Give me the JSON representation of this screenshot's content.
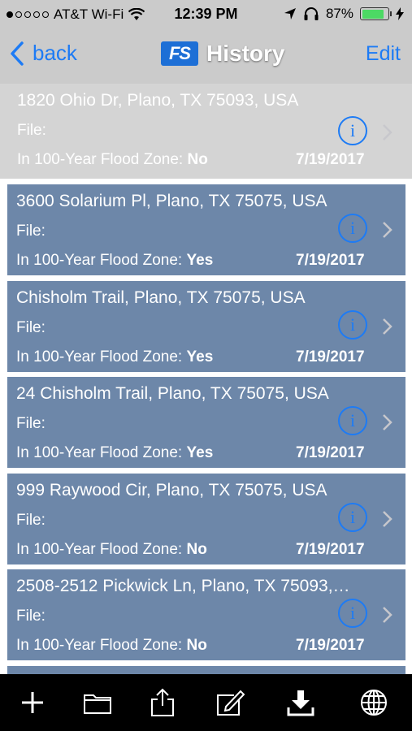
{
  "status_bar": {
    "carrier": "AT&T Wi-Fi",
    "time": "12:39 PM",
    "battery_percent": "87%",
    "battery_level": 0.87,
    "signal_dots_filled": 1,
    "signal_dots_total": 5
  },
  "nav": {
    "back_label": "back",
    "logo_text": "FS",
    "title": "History",
    "edit_label": "Edit"
  },
  "rows": [
    {
      "address": "1820 Ohio Dr, Plano, TX 75093, USA",
      "file_label": "File:",
      "flood_label": "In 100-Year Flood Zone:",
      "flood_value": "No",
      "date": "7/19/2017",
      "info_glyph": "i",
      "selected": true
    },
    {
      "address": "3600 Solarium Pl, Plano, TX 75075, USA",
      "file_label": "File:",
      "flood_label": "In 100-Year Flood Zone:",
      "flood_value": "Yes",
      "date": "7/19/2017",
      "info_glyph": "i"
    },
    {
      "address": "Chisholm Trail, Plano, TX 75075, USA",
      "file_label": "File:",
      "flood_label": "In 100-Year Flood Zone:",
      "flood_value": "Yes",
      "date": "7/19/2017",
      "info_glyph": "i"
    },
    {
      "address": "24 Chisholm Trail, Plano, TX 75075, USA",
      "file_label": "File:",
      "flood_label": "In 100-Year Flood Zone:",
      "flood_value": "Yes",
      "date": "7/19/2017",
      "info_glyph": "i"
    },
    {
      "address": "999 Raywood Cir, Plano, TX 75075, USA",
      "file_label": "File:",
      "flood_label": "In 100-Year Flood Zone:",
      "flood_value": "No",
      "date": "7/19/2017",
      "info_glyph": "i"
    },
    {
      "address": "2508-2512 Pickwick Ln, Plano, TX 75093,…",
      "file_label": "File:",
      "flood_label": "In 100-Year Flood Zone:",
      "flood_value": "No",
      "date": "7/19/2017",
      "info_glyph": "i"
    }
  ],
  "toolbar": {
    "icons": [
      "add-icon",
      "folder-icon",
      "share-icon",
      "compose-icon",
      "download-icon",
      "globe-icon"
    ]
  },
  "colors": {
    "accent": "#1d7bf5",
    "card": "#6d87a9",
    "selected_row": "#d4d4d4",
    "bar": "#cbcbcb",
    "battery": "#4cd964"
  }
}
